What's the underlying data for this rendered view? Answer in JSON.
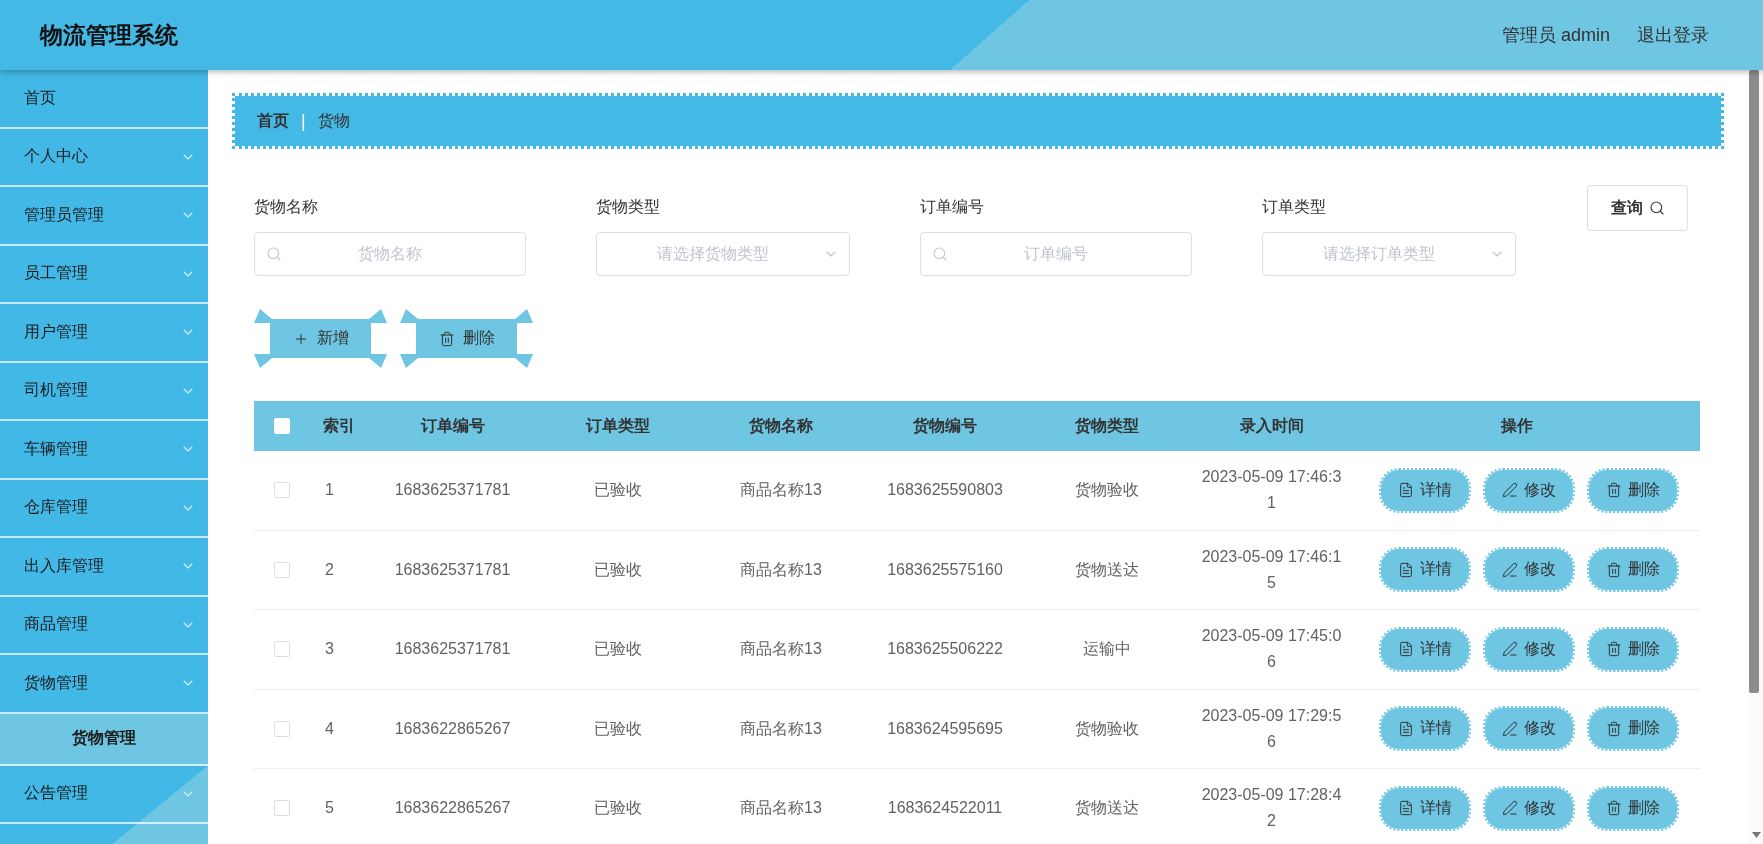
{
  "header": {
    "title": "物流管理系统",
    "user": "管理员 admin",
    "logout": "退出登录"
  },
  "sidebar": {
    "items": [
      {
        "label": "首页",
        "kind": "link"
      },
      {
        "label": "个人中心",
        "kind": "menu"
      },
      {
        "label": "管理员管理",
        "kind": "menu"
      },
      {
        "label": "员工管理",
        "kind": "menu"
      },
      {
        "label": "用户管理",
        "kind": "menu"
      },
      {
        "label": "司机管理",
        "kind": "menu"
      },
      {
        "label": "车辆管理",
        "kind": "menu"
      },
      {
        "label": "仓库管理",
        "kind": "menu"
      },
      {
        "label": "出入库管理",
        "kind": "menu"
      },
      {
        "label": "商品管理",
        "kind": "menu"
      },
      {
        "label": "货物管理",
        "kind": "menu",
        "children": [
          {
            "label": "货物管理",
            "selected": true
          }
        ]
      },
      {
        "label": "公告管理",
        "kind": "menu"
      }
    ]
  },
  "breadcrumb": {
    "home": "首页",
    "separator": "|",
    "current": "货物"
  },
  "filters": [
    {
      "label": "货物名称",
      "kind": "input",
      "placeholder": "货物名称"
    },
    {
      "label": "货物类型",
      "kind": "select",
      "placeholder": "请选择货物类型"
    },
    {
      "label": "订单编号",
      "kind": "input",
      "placeholder": "订单编号"
    },
    {
      "label": "订单类型",
      "kind": "select",
      "placeholder": "请选择订单类型"
    }
  ],
  "search_button": {
    "label": "查询"
  },
  "toolbar": [
    {
      "label": "新增",
      "kind": "add"
    },
    {
      "label": "删除",
      "kind": "delete"
    }
  ],
  "table": {
    "select_all": {
      "checked": false
    },
    "columns": [
      {
        "label": "索引",
        "kind": "index"
      },
      {
        "label": "订单编号",
        "kind": "text"
      },
      {
        "label": "订单类型",
        "kind": "text"
      },
      {
        "label": "货物名称",
        "kind": "text"
      },
      {
        "label": "货物编号",
        "kind": "text"
      },
      {
        "label": "货物类型",
        "kind": "text"
      },
      {
        "label": "录入时间",
        "kind": "time"
      },
      {
        "label": "操作",
        "kind": "actions"
      }
    ],
    "rows": [
      {
        "checked": false,
        "cells": [
          "1",
          "1683625371781",
          "已验收",
          "商品名称13",
          "1683625590803",
          "货物验收",
          "2023-05-09 17:46:31"
        ],
        "actions": [
          {
            "label": "详情",
            "kind": "detail"
          },
          {
            "label": "修改",
            "kind": "edit"
          },
          {
            "label": "删除",
            "kind": "delete"
          }
        ]
      },
      {
        "checked": false,
        "cells": [
          "2",
          "1683625371781",
          "已验收",
          "商品名称13",
          "1683625575160",
          "货物送达",
          "2023-05-09 17:46:15"
        ],
        "actions": [
          {
            "label": "详情",
            "kind": "detail"
          },
          {
            "label": "修改",
            "kind": "edit"
          },
          {
            "label": "删除",
            "kind": "delete"
          }
        ]
      },
      {
        "checked": false,
        "cells": [
          "3",
          "1683625371781",
          "已验收",
          "商品名称13",
          "1683625506222",
          "运输中",
          "2023-05-09 17:45:06"
        ],
        "actions": [
          {
            "label": "详情",
            "kind": "detail"
          },
          {
            "label": "修改",
            "kind": "edit"
          },
          {
            "label": "删除",
            "kind": "delete"
          }
        ]
      },
      {
        "checked": false,
        "cells": [
          "4",
          "1683622865267",
          "已验收",
          "商品名称13",
          "1683624595695",
          "货物验收",
          "2023-05-09 17:29:56"
        ],
        "actions": [
          {
            "label": "详情",
            "kind": "detail"
          },
          {
            "label": "修改",
            "kind": "edit"
          },
          {
            "label": "删除",
            "kind": "delete"
          }
        ]
      },
      {
        "checked": false,
        "cells": [
          "5",
          "1683622865267",
          "已验收",
          "商品名称13",
          "1683624522011",
          "货物送达",
          "2023-05-09 17:28:42"
        ],
        "actions": [
          {
            "label": "详情",
            "kind": "detail"
          },
          {
            "label": "修改",
            "kind": "edit"
          },
          {
            "label": "删除",
            "kind": "delete"
          }
        ]
      }
    ]
  }
}
